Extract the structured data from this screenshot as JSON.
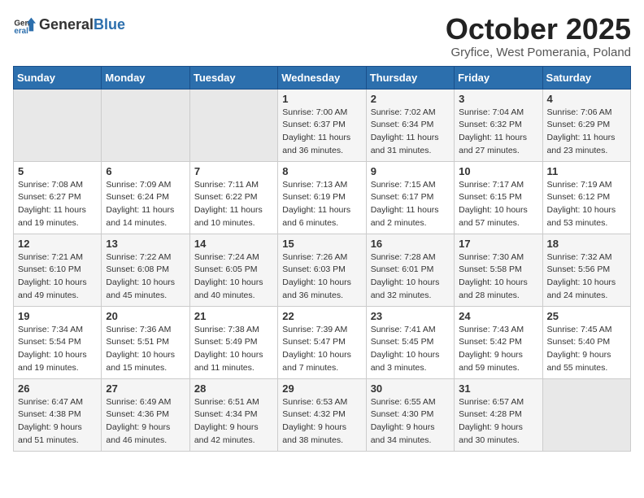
{
  "logo": {
    "text_general": "General",
    "text_blue": "Blue"
  },
  "header": {
    "month_title": "October 2025",
    "subtitle": "Gryfice, West Pomerania, Poland"
  },
  "days_of_week": [
    "Sunday",
    "Monday",
    "Tuesday",
    "Wednesday",
    "Thursday",
    "Friday",
    "Saturday"
  ],
  "weeks": [
    [
      {
        "day": "",
        "info": ""
      },
      {
        "day": "",
        "info": ""
      },
      {
        "day": "",
        "info": ""
      },
      {
        "day": "1",
        "info": "Sunrise: 7:00 AM\nSunset: 6:37 PM\nDaylight: 11 hours\nand 36 minutes."
      },
      {
        "day": "2",
        "info": "Sunrise: 7:02 AM\nSunset: 6:34 PM\nDaylight: 11 hours\nand 31 minutes."
      },
      {
        "day": "3",
        "info": "Sunrise: 7:04 AM\nSunset: 6:32 PM\nDaylight: 11 hours\nand 27 minutes."
      },
      {
        "day": "4",
        "info": "Sunrise: 7:06 AM\nSunset: 6:29 PM\nDaylight: 11 hours\nand 23 minutes."
      }
    ],
    [
      {
        "day": "5",
        "info": "Sunrise: 7:08 AM\nSunset: 6:27 PM\nDaylight: 11 hours\nand 19 minutes."
      },
      {
        "day": "6",
        "info": "Sunrise: 7:09 AM\nSunset: 6:24 PM\nDaylight: 11 hours\nand 14 minutes."
      },
      {
        "day": "7",
        "info": "Sunrise: 7:11 AM\nSunset: 6:22 PM\nDaylight: 11 hours\nand 10 minutes."
      },
      {
        "day": "8",
        "info": "Sunrise: 7:13 AM\nSunset: 6:19 PM\nDaylight: 11 hours\nand 6 minutes."
      },
      {
        "day": "9",
        "info": "Sunrise: 7:15 AM\nSunset: 6:17 PM\nDaylight: 11 hours\nand 2 minutes."
      },
      {
        "day": "10",
        "info": "Sunrise: 7:17 AM\nSunset: 6:15 PM\nDaylight: 10 hours\nand 57 minutes."
      },
      {
        "day": "11",
        "info": "Sunrise: 7:19 AM\nSunset: 6:12 PM\nDaylight: 10 hours\nand 53 minutes."
      }
    ],
    [
      {
        "day": "12",
        "info": "Sunrise: 7:21 AM\nSunset: 6:10 PM\nDaylight: 10 hours\nand 49 minutes."
      },
      {
        "day": "13",
        "info": "Sunrise: 7:22 AM\nSunset: 6:08 PM\nDaylight: 10 hours\nand 45 minutes."
      },
      {
        "day": "14",
        "info": "Sunrise: 7:24 AM\nSunset: 6:05 PM\nDaylight: 10 hours\nand 40 minutes."
      },
      {
        "day": "15",
        "info": "Sunrise: 7:26 AM\nSunset: 6:03 PM\nDaylight: 10 hours\nand 36 minutes."
      },
      {
        "day": "16",
        "info": "Sunrise: 7:28 AM\nSunset: 6:01 PM\nDaylight: 10 hours\nand 32 minutes."
      },
      {
        "day": "17",
        "info": "Sunrise: 7:30 AM\nSunset: 5:58 PM\nDaylight: 10 hours\nand 28 minutes."
      },
      {
        "day": "18",
        "info": "Sunrise: 7:32 AM\nSunset: 5:56 PM\nDaylight: 10 hours\nand 24 minutes."
      }
    ],
    [
      {
        "day": "19",
        "info": "Sunrise: 7:34 AM\nSunset: 5:54 PM\nDaylight: 10 hours\nand 19 minutes."
      },
      {
        "day": "20",
        "info": "Sunrise: 7:36 AM\nSunset: 5:51 PM\nDaylight: 10 hours\nand 15 minutes."
      },
      {
        "day": "21",
        "info": "Sunrise: 7:38 AM\nSunset: 5:49 PM\nDaylight: 10 hours\nand 11 minutes."
      },
      {
        "day": "22",
        "info": "Sunrise: 7:39 AM\nSunset: 5:47 PM\nDaylight: 10 hours\nand 7 minutes."
      },
      {
        "day": "23",
        "info": "Sunrise: 7:41 AM\nSunset: 5:45 PM\nDaylight: 10 hours\nand 3 minutes."
      },
      {
        "day": "24",
        "info": "Sunrise: 7:43 AM\nSunset: 5:42 PM\nDaylight: 9 hours\nand 59 minutes."
      },
      {
        "day": "25",
        "info": "Sunrise: 7:45 AM\nSunset: 5:40 PM\nDaylight: 9 hours\nand 55 minutes."
      }
    ],
    [
      {
        "day": "26",
        "info": "Sunrise: 6:47 AM\nSunset: 4:38 PM\nDaylight: 9 hours\nand 51 minutes."
      },
      {
        "day": "27",
        "info": "Sunrise: 6:49 AM\nSunset: 4:36 PM\nDaylight: 9 hours\nand 46 minutes."
      },
      {
        "day": "28",
        "info": "Sunrise: 6:51 AM\nSunset: 4:34 PM\nDaylight: 9 hours\nand 42 minutes."
      },
      {
        "day": "29",
        "info": "Sunrise: 6:53 AM\nSunset: 4:32 PM\nDaylight: 9 hours\nand 38 minutes."
      },
      {
        "day": "30",
        "info": "Sunrise: 6:55 AM\nSunset: 4:30 PM\nDaylight: 9 hours\nand 34 minutes."
      },
      {
        "day": "31",
        "info": "Sunrise: 6:57 AM\nSunset: 4:28 PM\nDaylight: 9 hours\nand 30 minutes."
      },
      {
        "day": "",
        "info": ""
      }
    ]
  ]
}
